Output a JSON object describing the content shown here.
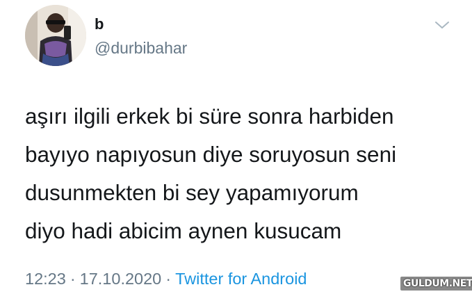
{
  "user": {
    "display_name": "b",
    "handle": "@durbibahar"
  },
  "tweet": {
    "text": "aşırı ilgili erkek bi süre sonra harbiden\nbayıyo napıyosun diye soruyosun seni\ndusunmekten bi sey yapamıyorum\ndiyo hadi abicim aynen kusucam",
    "time": "12:23",
    "date": "17.10.2020",
    "separator": "·",
    "source": "Twitter for Android"
  },
  "icons": {
    "menu": "chevron-down-icon"
  },
  "colors": {
    "text": "#14171a",
    "secondary": "#657786",
    "link": "#1b95e0"
  },
  "watermark": "GULDUM.NET"
}
